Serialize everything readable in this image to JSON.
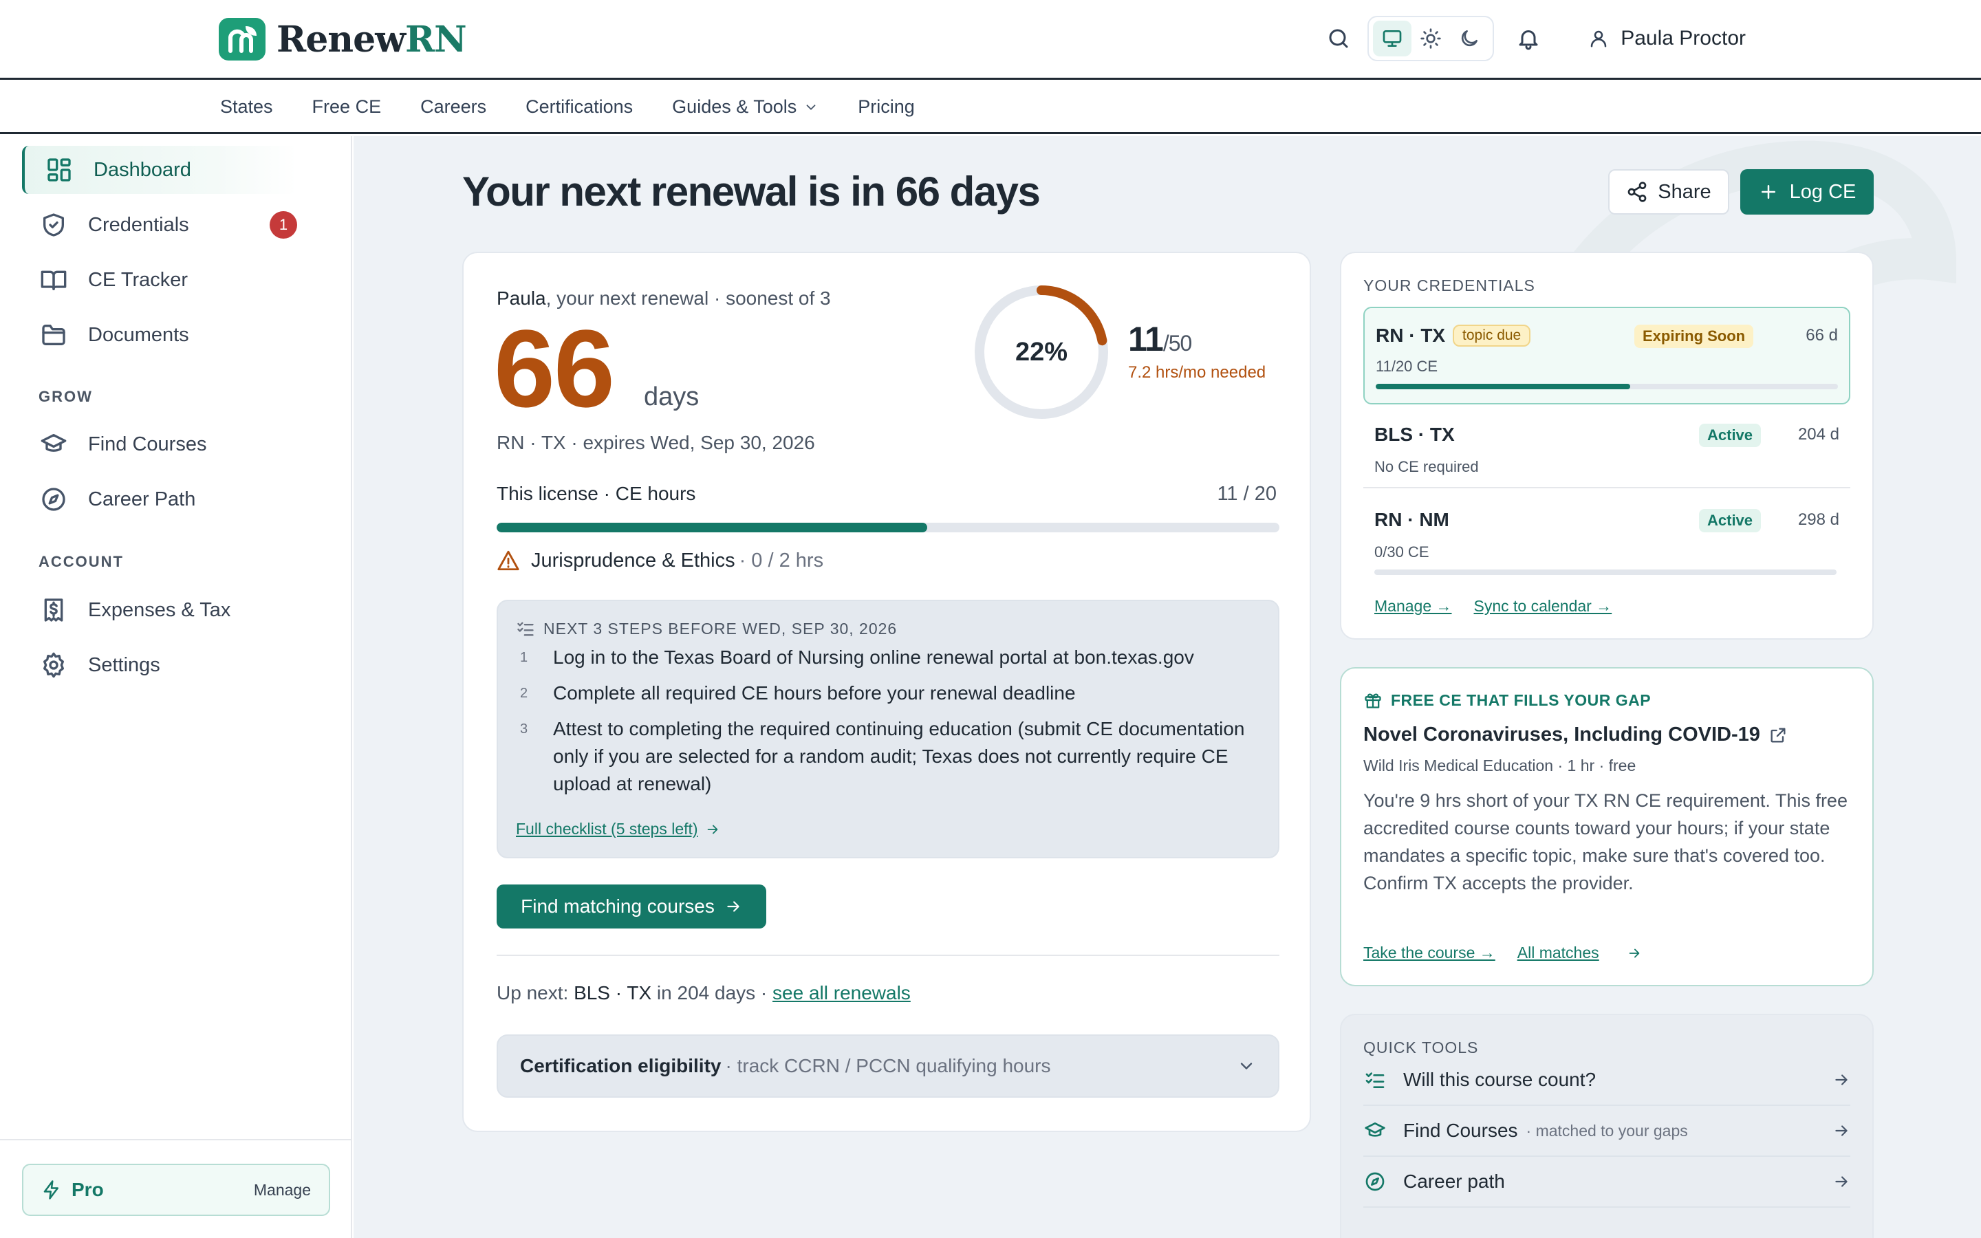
{
  "brand": {
    "name_prefix": "Renew",
    "name_suffix": "RN"
  },
  "header": {
    "user_name": "Paula Proctor"
  },
  "nav": {
    "items": [
      "States",
      "Free CE",
      "Careers",
      "Certifications",
      "Guides & Tools",
      "Pricing"
    ]
  },
  "sidebar": {
    "items": [
      {
        "label": "Dashboard",
        "icon": "dashboard-icon",
        "active": true
      },
      {
        "label": "Credentials",
        "icon": "shield-icon",
        "badge": "1"
      },
      {
        "label": "CE Tracker",
        "icon": "book-icon"
      },
      {
        "label": "Documents",
        "icon": "folder-icon"
      }
    ],
    "grow_heading": "GROW",
    "grow_items": [
      {
        "label": "Find Courses",
        "icon": "graduation-cap-icon"
      },
      {
        "label": "Career Path",
        "icon": "compass-icon"
      }
    ],
    "account_heading": "ACCOUNT",
    "account_items": [
      {
        "label": "Expenses & Tax",
        "icon": "receipt-dollar-icon"
      },
      {
        "label": "Settings",
        "icon": "gear-icon"
      }
    ],
    "plan": {
      "label": "Pro",
      "manage": "Manage"
    }
  },
  "main": {
    "title": "Your next renewal is in 66 days",
    "share_label": "Share",
    "log_label": "Log CE"
  },
  "renewal": {
    "name": "Paula",
    "subtitle": ", your next renewal · soonest of 3",
    "days": "66",
    "days_unit": "days",
    "license": "RN · TX · expires Wed, Sep 30, 2026",
    "progress_percent_text": "22%",
    "progress_fraction": 0.22,
    "hours_done": "11",
    "hours_total": "/50",
    "pace": "7.2 hrs/mo needed",
    "ce_label": "This license · CE hours",
    "ce_value": "11 / 20",
    "ce_fraction": 0.55,
    "topic_warning": "Jurisprudence & Ethics",
    "topic_hours": "· 0 / 2 hrs",
    "steps_heading": "NEXT 3 STEPS BEFORE WED, SEP 30, 2026",
    "steps": [
      {
        "num": "1",
        "text": "Log in to the Texas Board of Nursing online renewal portal at bon.texas.gov"
      },
      {
        "num": "2",
        "text": "Complete all required CE hours before your renewal deadline"
      },
      {
        "num": "3",
        "text": "Attest to completing the required continuing education (submit CE documentation only if you are selected for a random audit; Texas does not currently require CE upload at renewal)"
      }
    ],
    "checklist_link": "Full checklist (5 steps left)",
    "find_courses": "Find matching courses",
    "upnext_prefix": "Up next: ",
    "upnext_cred": "BLS · TX",
    "upnext_suffix": " in 204 days · ",
    "upnext_link": "see all renewals",
    "eligibility_title": "Certification eligibility",
    "eligibility_sub": "· track CCRN / PCCN qualifying hours"
  },
  "credentials": {
    "heading": "YOUR CREDENTIALS",
    "rows": [
      {
        "name": "RN · TX",
        "tag": "topic due",
        "status": "Expiring Soon",
        "days": "66 d",
        "sub": "11/20 CE",
        "fraction": 0.55
      },
      {
        "name": "BLS · TX",
        "status": "Active",
        "days": "204 d",
        "sub": "No CE required"
      },
      {
        "name": "RN · NM",
        "status": "Active",
        "days": "298 d",
        "sub": "0/30 CE",
        "fraction": 0
      }
    ],
    "manage_link": "Manage →",
    "sync_link": "Sync to calendar →"
  },
  "free_ce": {
    "heading": "FREE CE THAT FILLS YOUR GAP",
    "title": "Novel Coronaviruses, Including COVID-19",
    "meta": "Wild Iris Medical Education · 1 hr · free",
    "body": "You're 9 hrs short of your TX RN CE requirement. This free accredited course counts toward your hours; if your state mandates a specific topic, make sure that's covered too. Confirm TX accepts the provider.",
    "take_link": "Take the course →",
    "matches_link": "All matches"
  },
  "tools": {
    "heading": "QUICK TOOLS",
    "items": [
      {
        "label": "Will this course count?",
        "sub": "",
        "icon": "checklist-icon"
      },
      {
        "label": "Find Courses",
        "sub": "· matched to your gaps",
        "icon": "graduation-cap-icon"
      },
      {
        "label": "Career path",
        "sub": "",
        "icon": "compass-icon"
      }
    ]
  },
  "colors": {
    "accent": "#147867",
    "warning": "#b1500f",
    "badge": "#c53a3a"
  }
}
